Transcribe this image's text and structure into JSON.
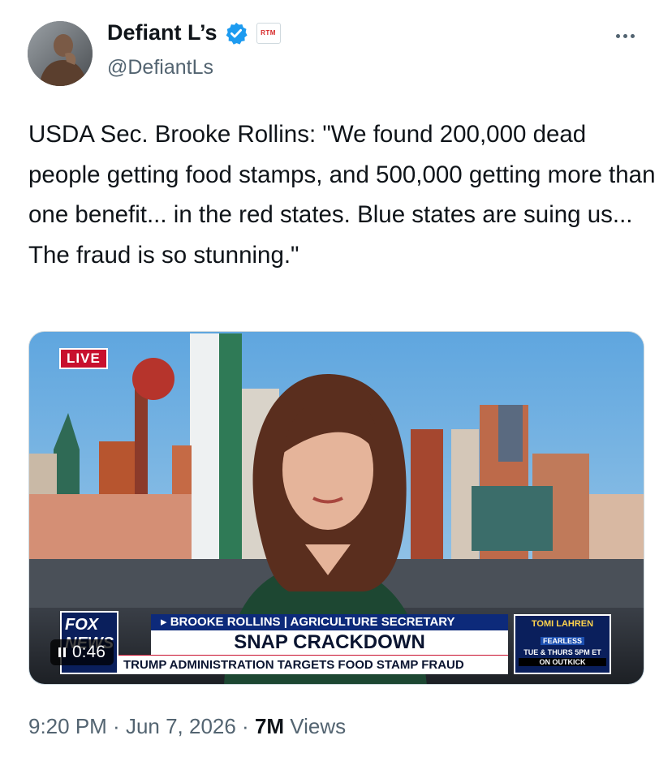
{
  "author": {
    "display_name": "Defiant L’s",
    "handle": "@DefiantLs",
    "badge_label": "RTM"
  },
  "tweet": {
    "text": "USDA Sec. Brooke Rollins: \"We found 200,000 dead people getting food stamps, and 500,000 getting more than one benefit... in the red states. Blue states are suing us... The fraud is so stunning.\""
  },
  "video": {
    "live_label": "LIVE",
    "chyron_name": "▸ BROOKE ROLLINS | AGRICULTURE SECRETARY",
    "chyron_headline": "SNAP CRACKDOWN",
    "chyron_subline": "TRUMP ADMINISTRATION TARGETS FOOD STAMP FRAUD",
    "network_logo": "FOX NEWS",
    "promo_title": "TOMI LAHREN",
    "promo_show": "FEARLESS",
    "promo_schedule": "TUE & THURS 5PM ET",
    "promo_channel": "ON OUTKICK",
    "time_remaining": "0:46"
  },
  "meta": {
    "time": "9:20 PM",
    "separator": " · ",
    "date": "Jun 7, 2026",
    "views_count": "7M",
    "views_label": " Views"
  },
  "icons": {
    "verified": "verified-badge-icon",
    "more": "more-options-icon",
    "pause": "pause-icon"
  },
  "colors": {
    "verified_blue": "#1d9bf0",
    "secondary_text": "#536471",
    "primary_text": "#0f1419",
    "live_red": "#c8102e"
  }
}
